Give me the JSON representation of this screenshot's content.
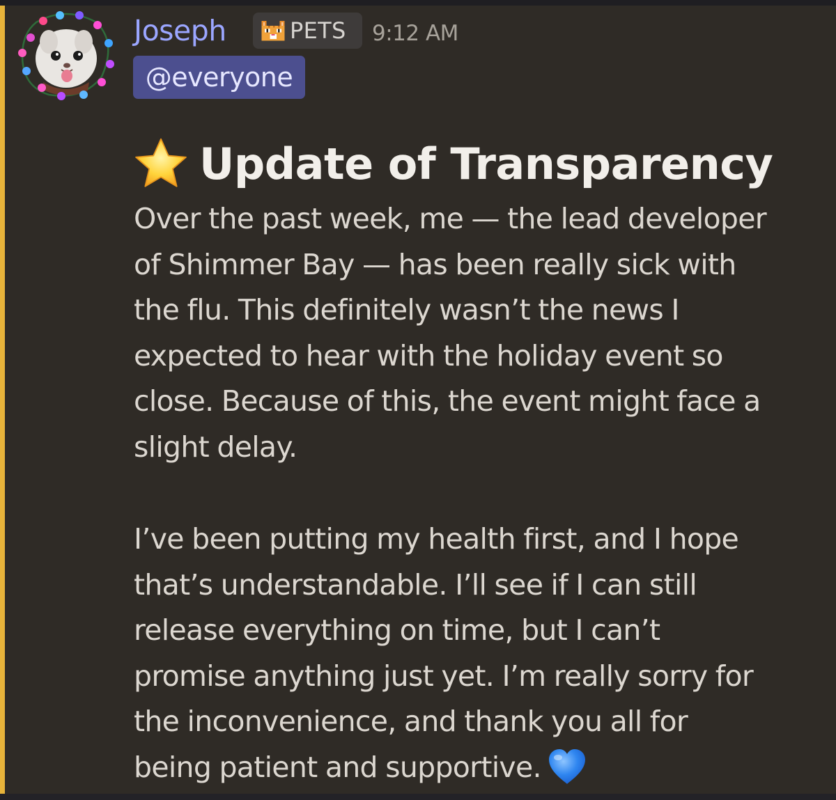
{
  "message": {
    "author": {
      "name": "Joseph",
      "role_tag": "PETS",
      "role_icon": "pixel-cat-icon",
      "avatar": "cat-avatar-with-christmas-lights"
    },
    "timestamp": "9:12 AM",
    "mention": "@everyone",
    "heading": {
      "icon": "star-emoji",
      "text": "Update of Transparency"
    },
    "paragraphs": [
      {
        "lines": [
          "Over the past week, me — the lead developer",
          "of Shimmer Bay — has been really sick with",
          "the flu. This definitely wasn’t the news I",
          "expected to hear with the holiday event so",
          "close. Because of this, the event might face a",
          "slight delay."
        ]
      },
      {
        "lines": [
          "I’ve been putting my health first, and I hope",
          "that’s understandable. I’ll see if I can still",
          "release everything on time, but I can’t",
          "promise anything just yet. I’m really sorry for",
          "the inconvenience, and thank you all for",
          "being patient and supportive."
        ],
        "trailing_icon": "blue-heart-emoji"
      }
    ],
    "colors": {
      "mention_highlight_bar": "#e7b33a",
      "username": "#9ba6ff",
      "mention_pill": "#4c4f8f",
      "background": "#2f2b26"
    }
  }
}
